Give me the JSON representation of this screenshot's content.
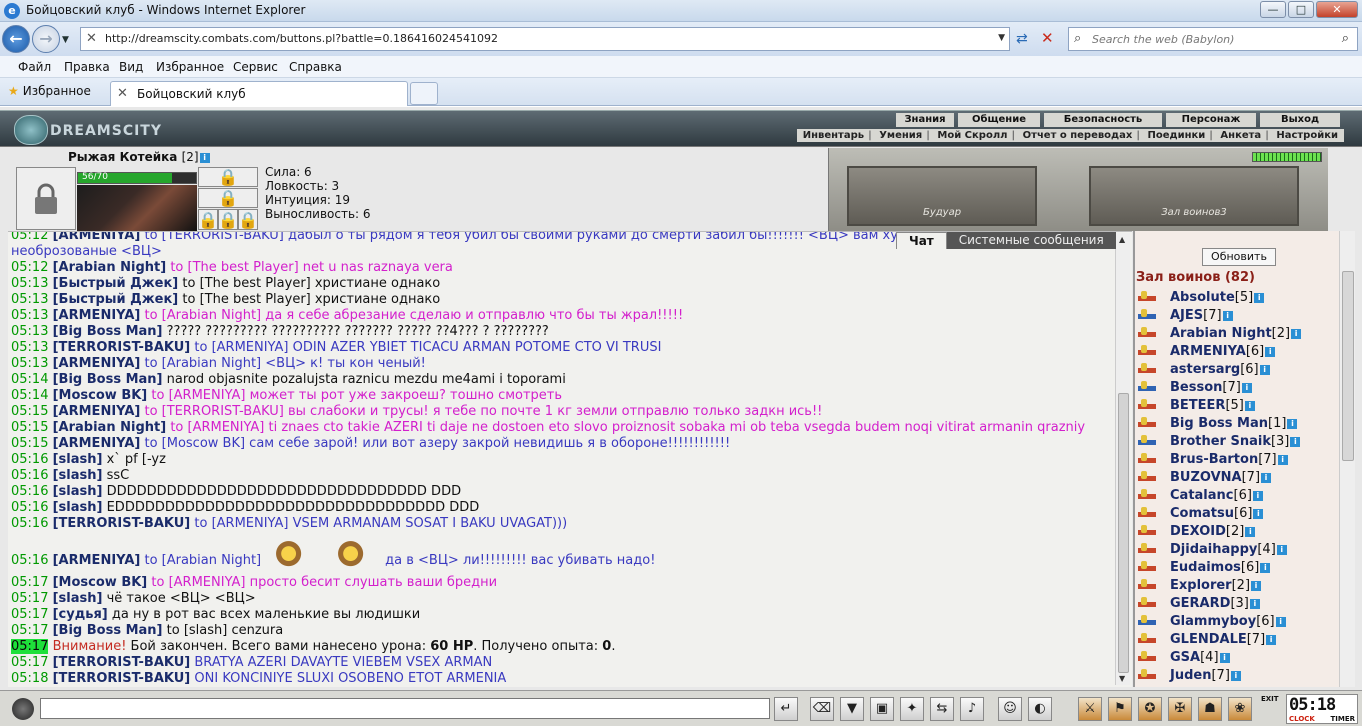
{
  "window": {
    "title": "Бойцовский клуб - Windows Internet Explorer",
    "btn_min": "—",
    "btn_max": "□",
    "btn_close": "✕"
  },
  "address": {
    "url": "http://dreamscity.combats.com/buttons.pl?battle=0.186416024541092",
    "search_placeholder": "Search the web (Babylon)"
  },
  "menu": [
    "Файл",
    "Правка",
    "Вид",
    "Избранное",
    "Сервис",
    "Справка"
  ],
  "tabs": {
    "favorites": "Избранное",
    "active_tab": "Бойцовский клуб"
  },
  "game": {
    "logo": "DREAMSCITY",
    "top_nav": [
      "Знания",
      "Общение",
      "Безопасность",
      "Персонаж",
      "Выход"
    ],
    "sub_nav": [
      "Инвентарь",
      "Умения",
      "Мой Скролл",
      "Отчет о переводах",
      "Поединки",
      "Анкета",
      "Настройки"
    ],
    "character": {
      "name": "Рыжая Котейка",
      "level": "[2]",
      "hp_text": "56/70",
      "hp_fraction": 0.8,
      "stats": [
        "Сила: 6",
        "Ловкость: 3",
        "Интуиция: 19",
        "Выносливость: 6"
      ]
    },
    "scene": {
      "door_left": "Будуар",
      "door_right": "Зал воинов3"
    },
    "chat_tabs": {
      "chat": "Чат",
      "system": "Системные сообщения"
    },
    "chat": [
      {
        "t": "05:12",
        "n": "[ARMENIYA]",
        "parts": [
          {
            "c": "to",
            "x": "to [TERRORIST-BAKU] дабыл о ты рядом я тебя убил бы своими руками до смерти забил бы!!!!!!! <ВЦ> вам хуй короткий а вы мразы необрозованые <ВЦ>"
          }
        ],
        "wrap": true
      },
      {
        "t": "05:12",
        "n": "[Arabian Night]",
        "parts": [
          {
            "c": "pm",
            "x": "to [The best Player] net u nas raznaya vera"
          }
        ]
      },
      {
        "t": "05:13",
        "n": "[Быстрый Джек]",
        "parts": [
          {
            "c": "",
            "x": "to [The best Player] христиане однако"
          }
        ]
      },
      {
        "t": "05:13",
        "n": "[Быстрый Джек]",
        "parts": [
          {
            "c": "",
            "x": "to [The best Player] христиане однако"
          }
        ]
      },
      {
        "t": "05:13",
        "n": "[ARMENIYA]",
        "parts": [
          {
            "c": "pm",
            "x": "to [Arabian Night] да я себе абрезание сделаю и отправлю что бы ты жрал!!!!!"
          }
        ]
      },
      {
        "t": "05:13",
        "n": "[Big Boss Man]",
        "parts": [
          {
            "c": "",
            "x": "????? ????????? ?????????? ??????? ????? ??4??? ? ????????"
          }
        ]
      },
      {
        "t": "05:13",
        "n": "[TERRORIST-BAKU]",
        "parts": [
          {
            "c": "to",
            "x": "to [ARMENIYA] ODIN AZER YBIET TICACU ARMAN POTOME CTO VI TRUSI"
          }
        ]
      },
      {
        "t": "05:13",
        "n": "[ARMENIYA]",
        "parts": [
          {
            "c": "to",
            "x": "to [Arabian Night] <ВЦ> к! ты кон ченый!"
          }
        ]
      },
      {
        "t": "05:14",
        "n": "[Big Boss Man]",
        "parts": [
          {
            "c": "",
            "x": "narod objasnite pozalujsta raznicu mezdu me4ami i toporami"
          }
        ]
      },
      {
        "t": "05:14",
        "n": "[Moscow BK]",
        "parts": [
          {
            "c": "pm",
            "x": "to [ARMENIYA] может ты рот уже закроеш? тошно смотреть"
          }
        ]
      },
      {
        "t": "05:15",
        "n": "[ARMENIYA]",
        "parts": [
          {
            "c": "pm",
            "x": "to [TERRORIST-BAKU] вы слабоки и трусы! я тебе по почте 1 кг земли отправлю только задкн ись!!"
          }
        ]
      },
      {
        "t": "05:15",
        "n": "[Arabian Night]",
        "parts": [
          {
            "c": "pm",
            "x": "to [ARMENIYA] ti znaes cto takie AZERI ti daje ne dostoen eto slovo proiznosit sobaka mi ob teba vsegda budem noqi vitirat armanin qrazniy"
          }
        ]
      },
      {
        "t": "05:15",
        "n": "[ARMENIYA]",
        "parts": [
          {
            "c": "to",
            "x": "to [Moscow BK] сам себе зарой! или вот азеру закрой невидишь я в обороне!!!!!!!!!!!!"
          }
        ]
      },
      {
        "t": "05:16",
        "n": "[slash]",
        "parts": [
          {
            "c": "",
            "x": "x` pf [-yz"
          }
        ]
      },
      {
        "t": "05:16",
        "n": "[slash]",
        "parts": [
          {
            "c": "",
            "x": "ssC"
          }
        ]
      },
      {
        "t": "05:16",
        "n": "[slash]",
        "parts": [
          {
            "c": "",
            "x": "DDDDDDDDDDDDDDDDDDDDDDDDDDDDDDDD DDD"
          }
        ]
      },
      {
        "t": "05:16",
        "n": "[slash]",
        "parts": [
          {
            "c": "",
            "x": "EDDDDDDDDDDDDDDDDDDDDDDDDDDDDDDDDD DDD"
          }
        ]
      },
      {
        "t": "05:16",
        "n": "[TERRORIST-BAKU]",
        "parts": [
          {
            "c": "to",
            "x": "to [ARMENIYA] VSEM ARMANAM SOSAT I BAKU UVAGAT)))"
          }
        ]
      },
      {
        "t": "05:16",
        "n": "[ARMENIYA]",
        "parts": [
          {
            "c": "to",
            "x": "to [Arabian Night]"
          },
          {
            "c": "emo",
            "x": ""
          },
          {
            "c": "emo",
            "x": ""
          },
          {
            "c": "to",
            "x": "да в <ВЦ> ли!!!!!!!!! вас убивать надо!"
          }
        ],
        "tall": true
      },
      {
        "t": "05:17",
        "n": "[Moscow BK]",
        "parts": [
          {
            "c": "pm",
            "x": "to [ARMENIYA] просто бесит слушать ваши бредни"
          }
        ]
      },
      {
        "t": "05:17",
        "n": "[slash]",
        "parts": [
          {
            "c": "",
            "x": "чё такое <ВЦ> <ВЦ>"
          }
        ]
      },
      {
        "t": "05:17",
        "n": "[судья]",
        "parts": [
          {
            "c": "",
            "x": "да ну в рот вас всех маленькие вы людишки"
          }
        ]
      },
      {
        "t": "05:17",
        "n": "[Big Boss Man]",
        "parts": [
          {
            "c": "",
            "x": "to [slash] cenzura"
          }
        ]
      },
      {
        "t": "05:17",
        "n": "",
        "hl": true,
        "parts": [
          {
            "c": "w",
            "x": "Внимание!"
          },
          {
            "c": "",
            "x": " Бой закончен. Всего вами нанесено урона: "
          },
          {
            "c": "b",
            "x": "60 HP"
          },
          {
            "c": "",
            "x": ". Получено опыта: "
          },
          {
            "c": "b",
            "x": "0"
          },
          {
            "c": "",
            "x": "."
          }
        ]
      },
      {
        "t": "05:17",
        "n": "[TERRORIST-BAKU]",
        "parts": [
          {
            "c": "to",
            "x": "BRATYA AZERI DAVAYTE VIEBEM VSEX ARMAN"
          }
        ]
      },
      {
        "t": "05:18",
        "n": "[TERRORIST-BAKU]",
        "parts": [
          {
            "c": "to",
            "x": "ONI KONCINIYE SLUXI OSOBENO ETOT ARMENIA"
          }
        ]
      }
    ],
    "right": {
      "refresh": "Обновить",
      "room": "Зал воинов (82)",
      "users": [
        {
          "n": "Absolute",
          "l": "[5]",
          "i": "r"
        },
        {
          "n": "AJES",
          "l": "[7]",
          "i": "b"
        },
        {
          "n": "Arabian Night",
          "l": "[2]",
          "i": "r"
        },
        {
          "n": "ARMENIYA",
          "l": "[6]",
          "i": "r"
        },
        {
          "n": "astersarg",
          "l": "[6]",
          "i": "r"
        },
        {
          "n": "Besson",
          "l": "[7]",
          "i": "b"
        },
        {
          "n": "BETEER",
          "l": "[5]",
          "i": "r"
        },
        {
          "n": "Big Boss Man",
          "l": "[1]",
          "i": "r"
        },
        {
          "n": "Brother Snaik",
          "l": "[3]",
          "i": "b"
        },
        {
          "n": "Brus-Barton",
          "l": "[7]",
          "i": "r"
        },
        {
          "n": "BUZOVNA",
          "l": "[7]",
          "i": "r"
        },
        {
          "n": "Catalanc",
          "l": "[6]",
          "i": "r"
        },
        {
          "n": "Comatsu",
          "l": "[6]",
          "i": "r"
        },
        {
          "n": "DEXOID",
          "l": "[2]",
          "i": "r"
        },
        {
          "n": "Djidaihappy",
          "l": "[4]",
          "i": "r"
        },
        {
          "n": "Eudaimos",
          "l": "[6]",
          "i": "r"
        },
        {
          "n": "Explorer",
          "l": "[2]",
          "i": "r"
        },
        {
          "n": "GERARD",
          "l": "[3]",
          "i": "r"
        },
        {
          "n": "Glammyboy",
          "l": "[6]",
          "i": "b"
        },
        {
          "n": "GLENDALE",
          "l": "[7]",
          "i": "r"
        },
        {
          "n": "GSA",
          "l": "[4]",
          "i": "r"
        },
        {
          "n": "Juden",
          "l": "[7]",
          "i": "r"
        }
      ]
    },
    "clock": {
      "time": "05:18",
      "label_clock": "CLOCK",
      "label_timer": "TIMER",
      "exit": "EXIT"
    }
  }
}
